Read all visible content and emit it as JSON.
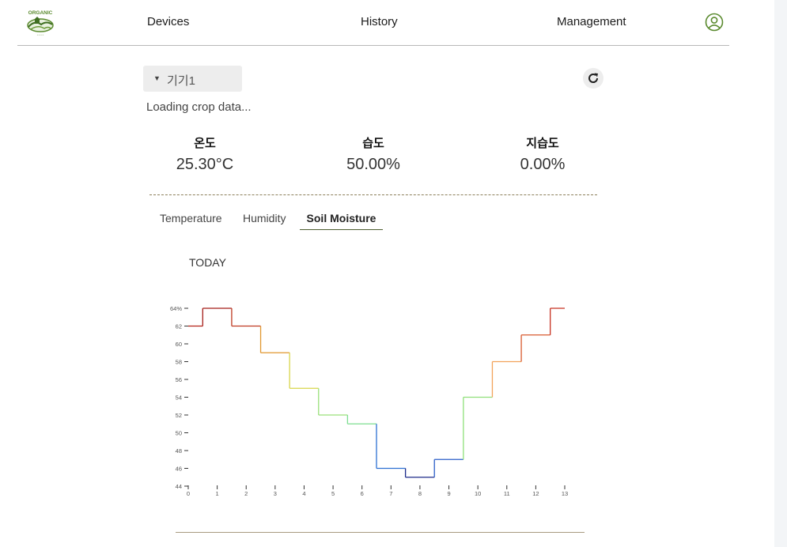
{
  "nav": {
    "logo_text": "ORGANIC",
    "devices": "Devices",
    "history": "History",
    "management": "Management",
    "profile_icon": "user-circle-icon"
  },
  "device": {
    "selected": "기기1",
    "caret_icon": "caret-down-icon",
    "refresh_icon": "refresh-icon"
  },
  "status": {
    "loading": "Loading crop data..."
  },
  "stats": {
    "temperature": {
      "label": "온도",
      "value": "25.30°C"
    },
    "humidity": {
      "label": "습도",
      "value": "50.00%"
    },
    "soil": {
      "label": "지습도",
      "value": "0.00%"
    }
  },
  "tabs": {
    "items": [
      "Temperature",
      "Humidity",
      "Soil Moisture"
    ],
    "active": "Soil Moisture"
  },
  "chart_title": "TODAY",
  "chart_data": {
    "type": "line",
    "step": true,
    "x": [
      0,
      1,
      2,
      3,
      4,
      5,
      6,
      7,
      8,
      9,
      10,
      11,
      12,
      13
    ],
    "values": [
      62,
      64,
      62,
      59,
      55,
      52,
      51,
      46,
      45,
      47,
      54,
      58,
      61,
      64
    ],
    "colors": [
      "#b32318",
      "#a41c18",
      "#bf3a22",
      "#e0962e",
      "#d8d64a",
      "#9ae07a",
      "#7ede90",
      "#2d6fd2",
      "#1c2a8a",
      "#2a5ec8",
      "#8fe07a",
      "#f2a25a",
      "#d85a2e",
      "#c63020"
    ],
    "xlim": [
      0,
      13
    ],
    "ylim": [
      44,
      64
    ],
    "yticks": [
      "64%",
      "62",
      "60",
      "58",
      "56",
      "54",
      "52",
      "50",
      "48",
      "46",
      "44"
    ],
    "xticks": [
      "0",
      "1",
      "2",
      "3",
      "4",
      "5",
      "6",
      "7",
      "8",
      "9",
      "10",
      "11",
      "12",
      "13"
    ]
  },
  "colors": {
    "accent": "#4d5e2f",
    "logo_green": "#5a8a2e"
  }
}
